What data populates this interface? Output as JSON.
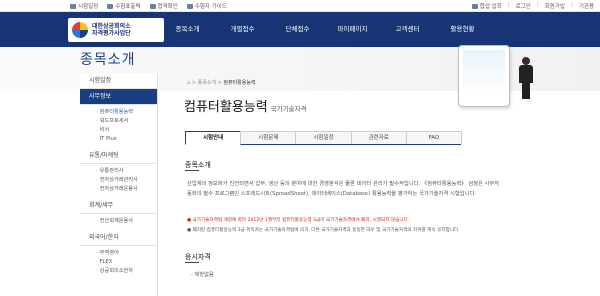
{
  "topbar": {
    "left": [
      "시험일정",
      "수험표출력",
      "합격확인",
      "수험자 가이드"
    ],
    "right": [
      "합업 입회",
      "로그인",
      "회원가입",
      "기관용"
    ]
  },
  "logo": {
    "line1": "대한상공회의소",
    "line2": "자격평가사업단"
  },
  "nav": {
    "items": [
      "종목소개",
      "개별접수",
      "단체접수",
      "마이페이지",
      "고객센터",
      "활용현황"
    ]
  },
  "hero": {
    "title": "종목소개"
  },
  "sidebar": {
    "groups": [
      {
        "label": "시험일정",
        "active": false,
        "subs": []
      },
      {
        "label": "사무정보",
        "active": true,
        "subs": [
          "컴퓨터활용능력",
          "워드프로세서",
          "비서",
          "IT Plus"
        ]
      },
      {
        "label": "유통/마케팅",
        "active": false,
        "subs": [
          "유통관리사",
          "전자상거래관리사",
          "전자상거래운용사"
        ]
      },
      {
        "label": "회계/세무",
        "active": false,
        "subs": [
          "전산회계운용사"
        ]
      },
      {
        "label": "외국어/한자",
        "active": false,
        "subs": [
          "무역영어",
          "FLEX",
          "상공회의소한자"
        ]
      }
    ],
    "current": "컴퓨터활용능력"
  },
  "breadcrumb": {
    "home": "⌂",
    "items": [
      "종목소개",
      "컴퓨터활용능력"
    ]
  },
  "page": {
    "title": "컴퓨터활용능력",
    "subtitle": "국가기술자격"
  },
  "tabs": [
    "시험안내",
    "시험문제",
    "시험일정",
    "관련자료",
    "FAQ"
  ],
  "intro": {
    "heading": "종목소개",
    "paragraph": "산업계의 정보화가 진전되면서 업무, 생산 등의 분야에 대한 경영분석은 물론 데이터 관리가 필수적입니다. 《컴퓨터활용능력》 검정은 사무자동화의 필수 프로그램인 스프레드시트(SpreadSheet), 데이터베이스(Database) 활용능력을 평가하는 국가기술자격 시험입니다.",
    "note_red": "국가기술자격법 개정에 따라 2012년 1월부터 컴퓨터활용능력 3급이 국가기술자격에서 폐지, 시행되지 않습니다.",
    "note": "폐지된 컴퓨터활용능력 3급 취득자는 국가기술자격법에 의거, 다른 국가기술자격과 동등한 대우 및 국가기술자격의 지위를 계속 유지합니다."
  },
  "qualification": {
    "heading": "응시자격",
    "value": "제한없음"
  }
}
